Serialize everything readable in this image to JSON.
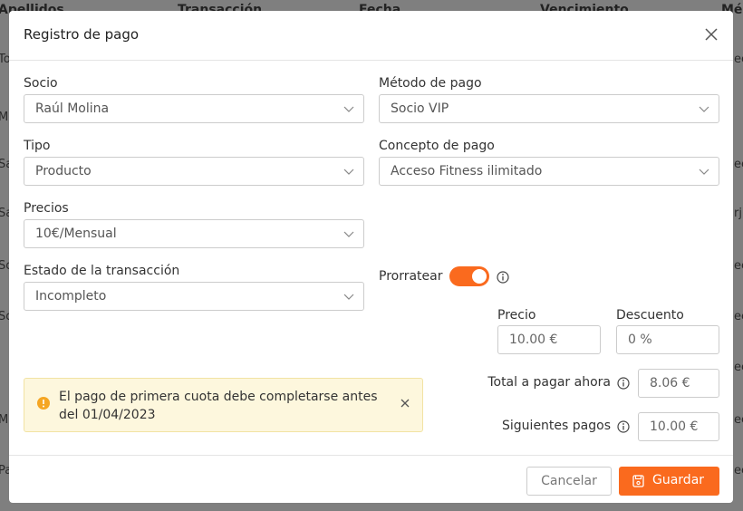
{
  "background_table": {
    "headers": [
      "Apellidos",
      "Transacción",
      "Fecha",
      "Vencimiento",
      "Mé"
    ],
    "left_fragments": [
      "To",
      "M",
      "Sa",
      "Sa",
      "So",
      "So",
      "M",
      "Pa"
    ],
    "right_fragments": [
      "ee",
      "ee",
      "rj",
      "ee",
      "ee",
      "ee",
      "ee",
      "ee"
    ]
  },
  "modal": {
    "title": "Registro de pago",
    "fields": {
      "socio": {
        "label": "Socio",
        "value": "Raúl Molina"
      },
      "metodo_pago": {
        "label": "Método de pago",
        "value": "Socio VIP"
      },
      "tipo": {
        "label": "Tipo",
        "value": "Producto"
      },
      "concepto_pago": {
        "label": "Concepto de pago",
        "value": "Acceso Fitness ilimitado"
      },
      "precios": {
        "label": "Precios",
        "value": "10€/Mensual"
      },
      "estado_transaccion": {
        "label": "Estado de la transacción",
        "value": "Incompleto"
      }
    },
    "prorratear": {
      "label": "Prorratear",
      "enabled": true
    },
    "precio": {
      "label": "Precio",
      "value": "10.00 €"
    },
    "descuento": {
      "label": "Descuento",
      "value": "0 %"
    },
    "total_pagar_ahora": {
      "label": "Total a pagar ahora",
      "value": "8.06 €"
    },
    "siguientes_pagos": {
      "label": "Siguientes pagos",
      "value": "10.00 €"
    },
    "alert": {
      "text": "El pago de primera cuota debe completarse antes del 01/04/2023"
    },
    "footer": {
      "cancel_label": "Cancelar",
      "save_label": "Guardar"
    }
  },
  "colors": {
    "accent": "#fa6a1e",
    "alert_bg": "#fdf7dd",
    "alert_icon": "#f5a623"
  },
  "icons": [
    "close-icon",
    "chevron-down-icon",
    "info-icon",
    "warning-icon",
    "save-icon"
  ]
}
